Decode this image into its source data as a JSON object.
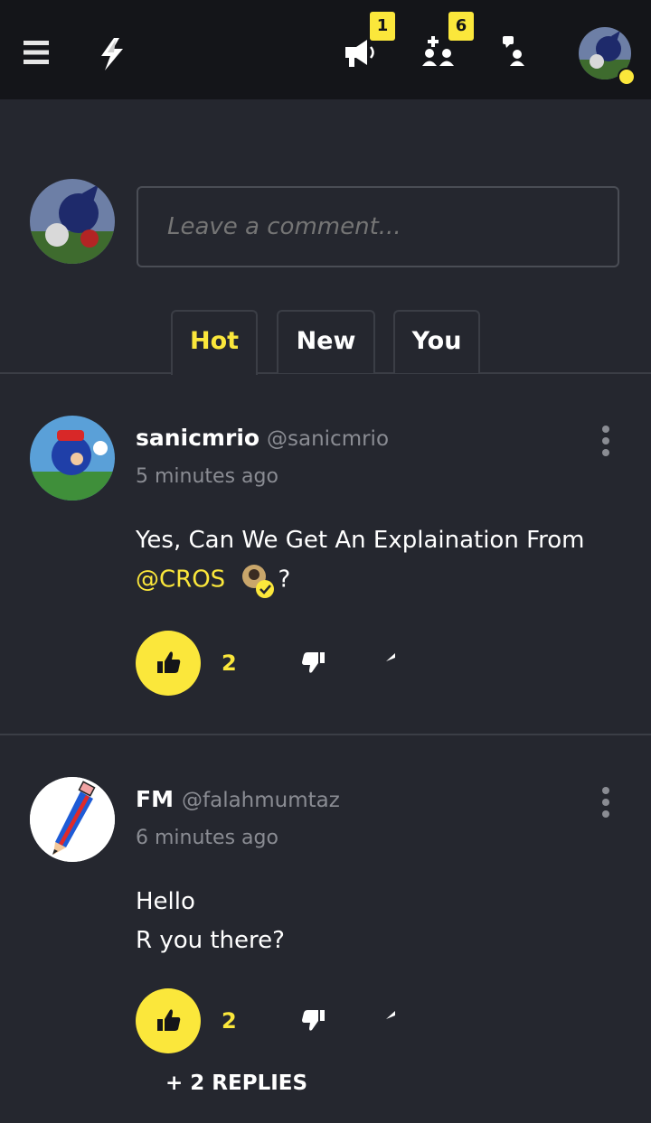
{
  "header": {
    "menu_icon": "hamburger-menu-icon",
    "logo_icon": "lightning-bolt-logo-icon",
    "announcements_icon": "megaphone-icon",
    "announcements_badge": "1",
    "friends_icon": "add-friend-icon",
    "friends_badge": "6",
    "chat_icon": "chat-user-icon",
    "status_color": "#fbe73b"
  },
  "composer": {
    "placeholder": "Leave a comment..."
  },
  "tabs": [
    {
      "label": "Hot",
      "active": true
    },
    {
      "label": "New",
      "active": false
    },
    {
      "label": "You",
      "active": false
    }
  ],
  "comments": [
    {
      "username": "sanicmrio",
      "handle": "@sanicmrio",
      "time": "5 minutes ago",
      "text_before": "Yes, Can We Get An Explaination From",
      "mention": "@CROS",
      "text_after": "?",
      "likes": "2"
    },
    {
      "username": "FM",
      "handle": "@falahmumtaz",
      "time": "6 minutes ago",
      "line1": "Hello",
      "line2": "R you there?",
      "likes": "2",
      "replies_label": "+ 2 REPLIES"
    }
  ],
  "colors": {
    "accent": "#fbe73b",
    "background": "#25272f",
    "topbar": "#141519"
  }
}
